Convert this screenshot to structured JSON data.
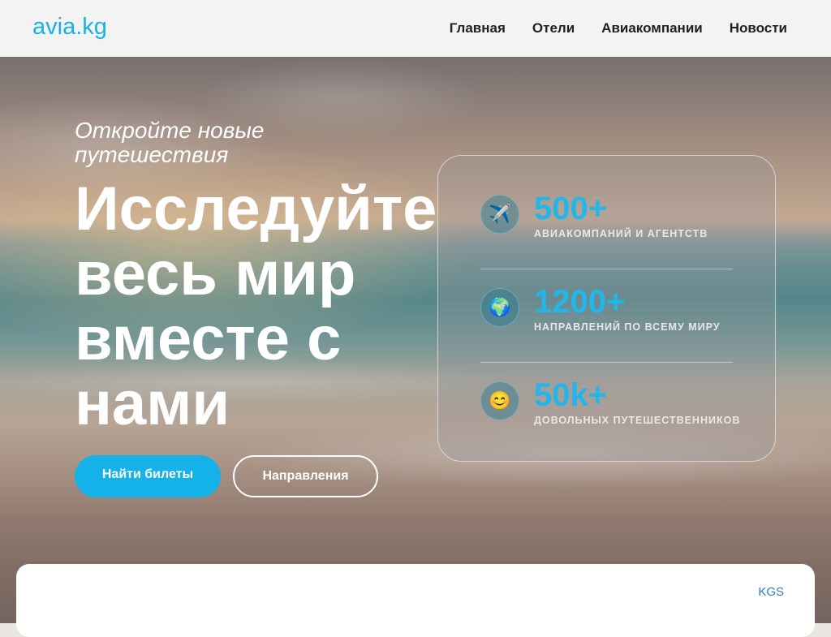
{
  "header": {
    "logo": "avia.kg",
    "nav": [
      "Главная",
      "Отели",
      "Авиакомпании",
      "Новости"
    ]
  },
  "hero": {
    "kicker": "Откройте новые путешествия",
    "headline": "Исследуйте весь мир вместе с нами",
    "primary_button": "Найти билеты",
    "secondary_button": "Направления"
  },
  "stats": [
    {
      "icon": "airplane-icon",
      "glyph": "✈️",
      "value": "500+",
      "label": "АВИАКОМПАНИЙ И АГЕНТСТВ"
    },
    {
      "icon": "globe-icon",
      "glyph": "🌍",
      "value": "1200+",
      "label": "НАПРАВЛЕНИЙ ПО ВСЕМУ МИРУ"
    },
    {
      "icon": "smile-icon",
      "glyph": "😊",
      "value": "50k+",
      "label": "ДОВОЛЬНЫХ ПУТЕШЕСТВЕННИКОВ"
    }
  ],
  "search_panel": {
    "currency": "KGS"
  },
  "colors": {
    "accent": "#14b2e8",
    "stat_number": "#22b6ea"
  }
}
